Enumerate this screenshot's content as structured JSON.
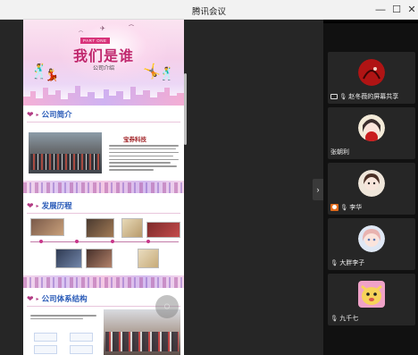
{
  "window": {
    "title": "腾讯会议",
    "minimize_glyph": "—",
    "maximize_glyph": "☐",
    "close_glyph": "✕"
  },
  "slide": {
    "part_badge": "PART ONE",
    "banner_title": "我们是谁",
    "banner_subtitle": "公司介绍",
    "sections": [
      {
        "label": "公司简介"
      },
      {
        "label": "发展历程"
      },
      {
        "label": "公司体系结构"
      }
    ],
    "company_logo_text": "宝券科技"
  },
  "sidebar": {
    "collapse_glyph": "›",
    "participants": [
      {
        "name": "赵冬薇的屏幕共享",
        "icon": "screen-share-icon",
        "avatar_colors": [
          "#b01414",
          "#3a0505"
        ]
      },
      {
        "name": "张朝利",
        "icon": "",
        "avatar_colors": [
          "#f3ead8",
          "#e4c6c0"
        ]
      },
      {
        "name": "李华",
        "icon": "host-icon",
        "avatar_colors": [
          "#efe6da",
          "#caa58a"
        ]
      },
      {
        "name": "大胖李子",
        "icon": "",
        "avatar_colors": [
          "#dfe7f4",
          "#e8b3b0"
        ]
      },
      {
        "name": "九千七",
        "icon": "",
        "avatar_colors": [
          "#f0a2c8",
          "#f7d35a"
        ]
      }
    ]
  },
  "colors": {
    "titlebar_bg": "#f2f2f2",
    "stage_bg": "#262626",
    "sidebar_bg": "#111111",
    "section_blue": "#2a5bb8",
    "accent_pink": "#c0286e"
  }
}
